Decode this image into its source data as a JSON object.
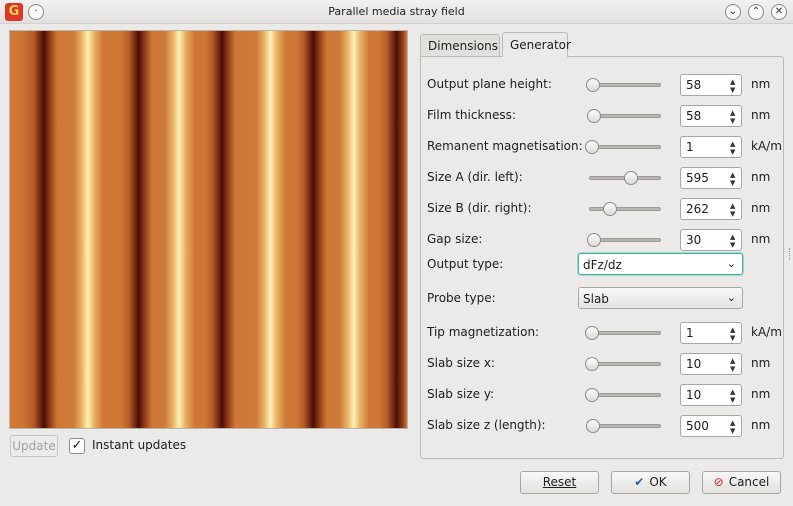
{
  "window": {
    "title": "Parallel media stray field",
    "app_icon": "gwyddion-icon",
    "menu_icon_glyph": "·",
    "buttons": {
      "minimize": "⌄",
      "maximize": "⌃",
      "close": "✕"
    }
  },
  "preview": {
    "update_label": "Update",
    "instant_updates_label": "Instant updates",
    "instant_updates_checked": true
  },
  "tabs": [
    {
      "label": "Dimensions",
      "active": false
    },
    {
      "label": "Generator",
      "active": true
    }
  ],
  "params": [
    {
      "label": "Output plane height:",
      "value": "58",
      "unit": "nm",
      "slider": 0.02
    },
    {
      "label": "Film thickness:",
      "value": "58",
      "unit": "nm",
      "slider": 0.03
    },
    {
      "label": "Remanent magnetisation:",
      "value": "1",
      "unit": "kA/m",
      "slider": 0.0
    },
    {
      "label": "Size A (dir. left):",
      "value": "595",
      "unit": "nm",
      "slider": 0.59
    },
    {
      "label": "Size B (dir. right):",
      "value": "262",
      "unit": "nm",
      "slider": 0.28
    },
    {
      "label": "Gap size:",
      "value": "30",
      "unit": "nm",
      "slider": 0.03
    }
  ],
  "output_type": {
    "label": "Output type:",
    "value": "dFz/dz"
  },
  "probe_type": {
    "label": "Probe type:",
    "value": "Slab"
  },
  "probe_params": [
    {
      "label": "Tip magnetization:",
      "value": "1",
      "unit": "kA/m",
      "slider": 0.0
    },
    {
      "label": "Slab size x:",
      "value": "10",
      "unit": "nm",
      "slider": 0.0
    },
    {
      "label": "Slab size y:",
      "value": "10",
      "unit": "nm",
      "slider": 0.0
    },
    {
      "label": "Slab size z (length):",
      "value": "500",
      "unit": "nm",
      "slider": 0.01
    }
  ],
  "actions": {
    "reset": "Reset",
    "ok": "OK",
    "cancel": "Cancel"
  },
  "colors": {
    "accent": "#4bb3a6",
    "ok_icon": "#2a5fa8",
    "cancel_icon": "#cc2a22"
  }
}
